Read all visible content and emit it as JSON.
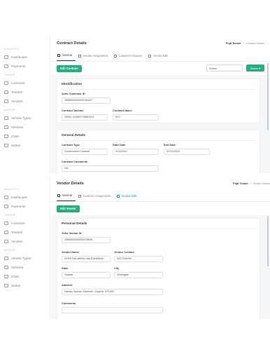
{
  "sidebar": {
    "section_top": "ANALYTICS",
    "section_mid": "TENDER",
    "section_bottom": "MASTER",
    "items_top": [
      "Dashboard",
      "Payments"
    ],
    "items_mid": [
      "Contracts",
      "Tenders",
      "Vendors"
    ],
    "items_bottom": [
      "Vehicle Types",
      "Vehicles",
      "Cities",
      "States"
    ]
  },
  "contract": {
    "title": "Contract Details",
    "breadcrumb_parent": "Pujit Tender",
    "breadcrumb_sep": ">",
    "breadcrumb_current": "Contract Details",
    "tabs": [
      "General",
      "Vendor Assignment",
      "Customer Invoices",
      "Vendor Bills"
    ],
    "edit_button": "Edit Contract",
    "status_select": "Active",
    "status_button": "Status",
    "identification": {
      "title": "Identification",
      "customer_id_label": "Zoho Customer ID",
      "customer_id": "1988632000000034437",
      "number_label": "Contract Number",
      "number": "GENC-9118877/6881021",
      "name_label": "Contract Name",
      "name": "ISO"
    },
    "general": {
      "title": "General Details",
      "type_label": "Contract Type",
      "type": "Government Contract",
      "start_label": "Start Date",
      "start": "1/11/2024",
      "end_label": "End Date",
      "end": "31/12/2024",
      "comments_label": "Contract Comments",
      "comments": "NA"
    }
  },
  "vendor": {
    "title": "Vendor Details",
    "breadcrumb_parent": "Pujit Tender",
    "breadcrumb_sep": ">",
    "breadcrumb_current": "Vendor Details",
    "tabs": [
      "General",
      "Contract Assignments",
      "Vendor Bills"
    ],
    "edit_button": "Edit Vendor",
    "personal": {
      "title": "Personal Details",
      "vendor_id_label": "Zoho Vendor ID",
      "vendor_id": "1988632000000078635",
      "name_label": "Vendor Name",
      "name": "AYER DALABHAI NAGDANBHAI",
      "contact_label": "Vendor Contact",
      "contact": "9327346094",
      "state_label": "State",
      "state": "Gujarat",
      "city_label": "City",
      "city": "Viramgam",
      "address_label": "Address",
      "address": "Nanda, Nanda, Kachchh, Gujarat, 370165",
      "comments_label": "Comments",
      "comments": ""
    }
  }
}
